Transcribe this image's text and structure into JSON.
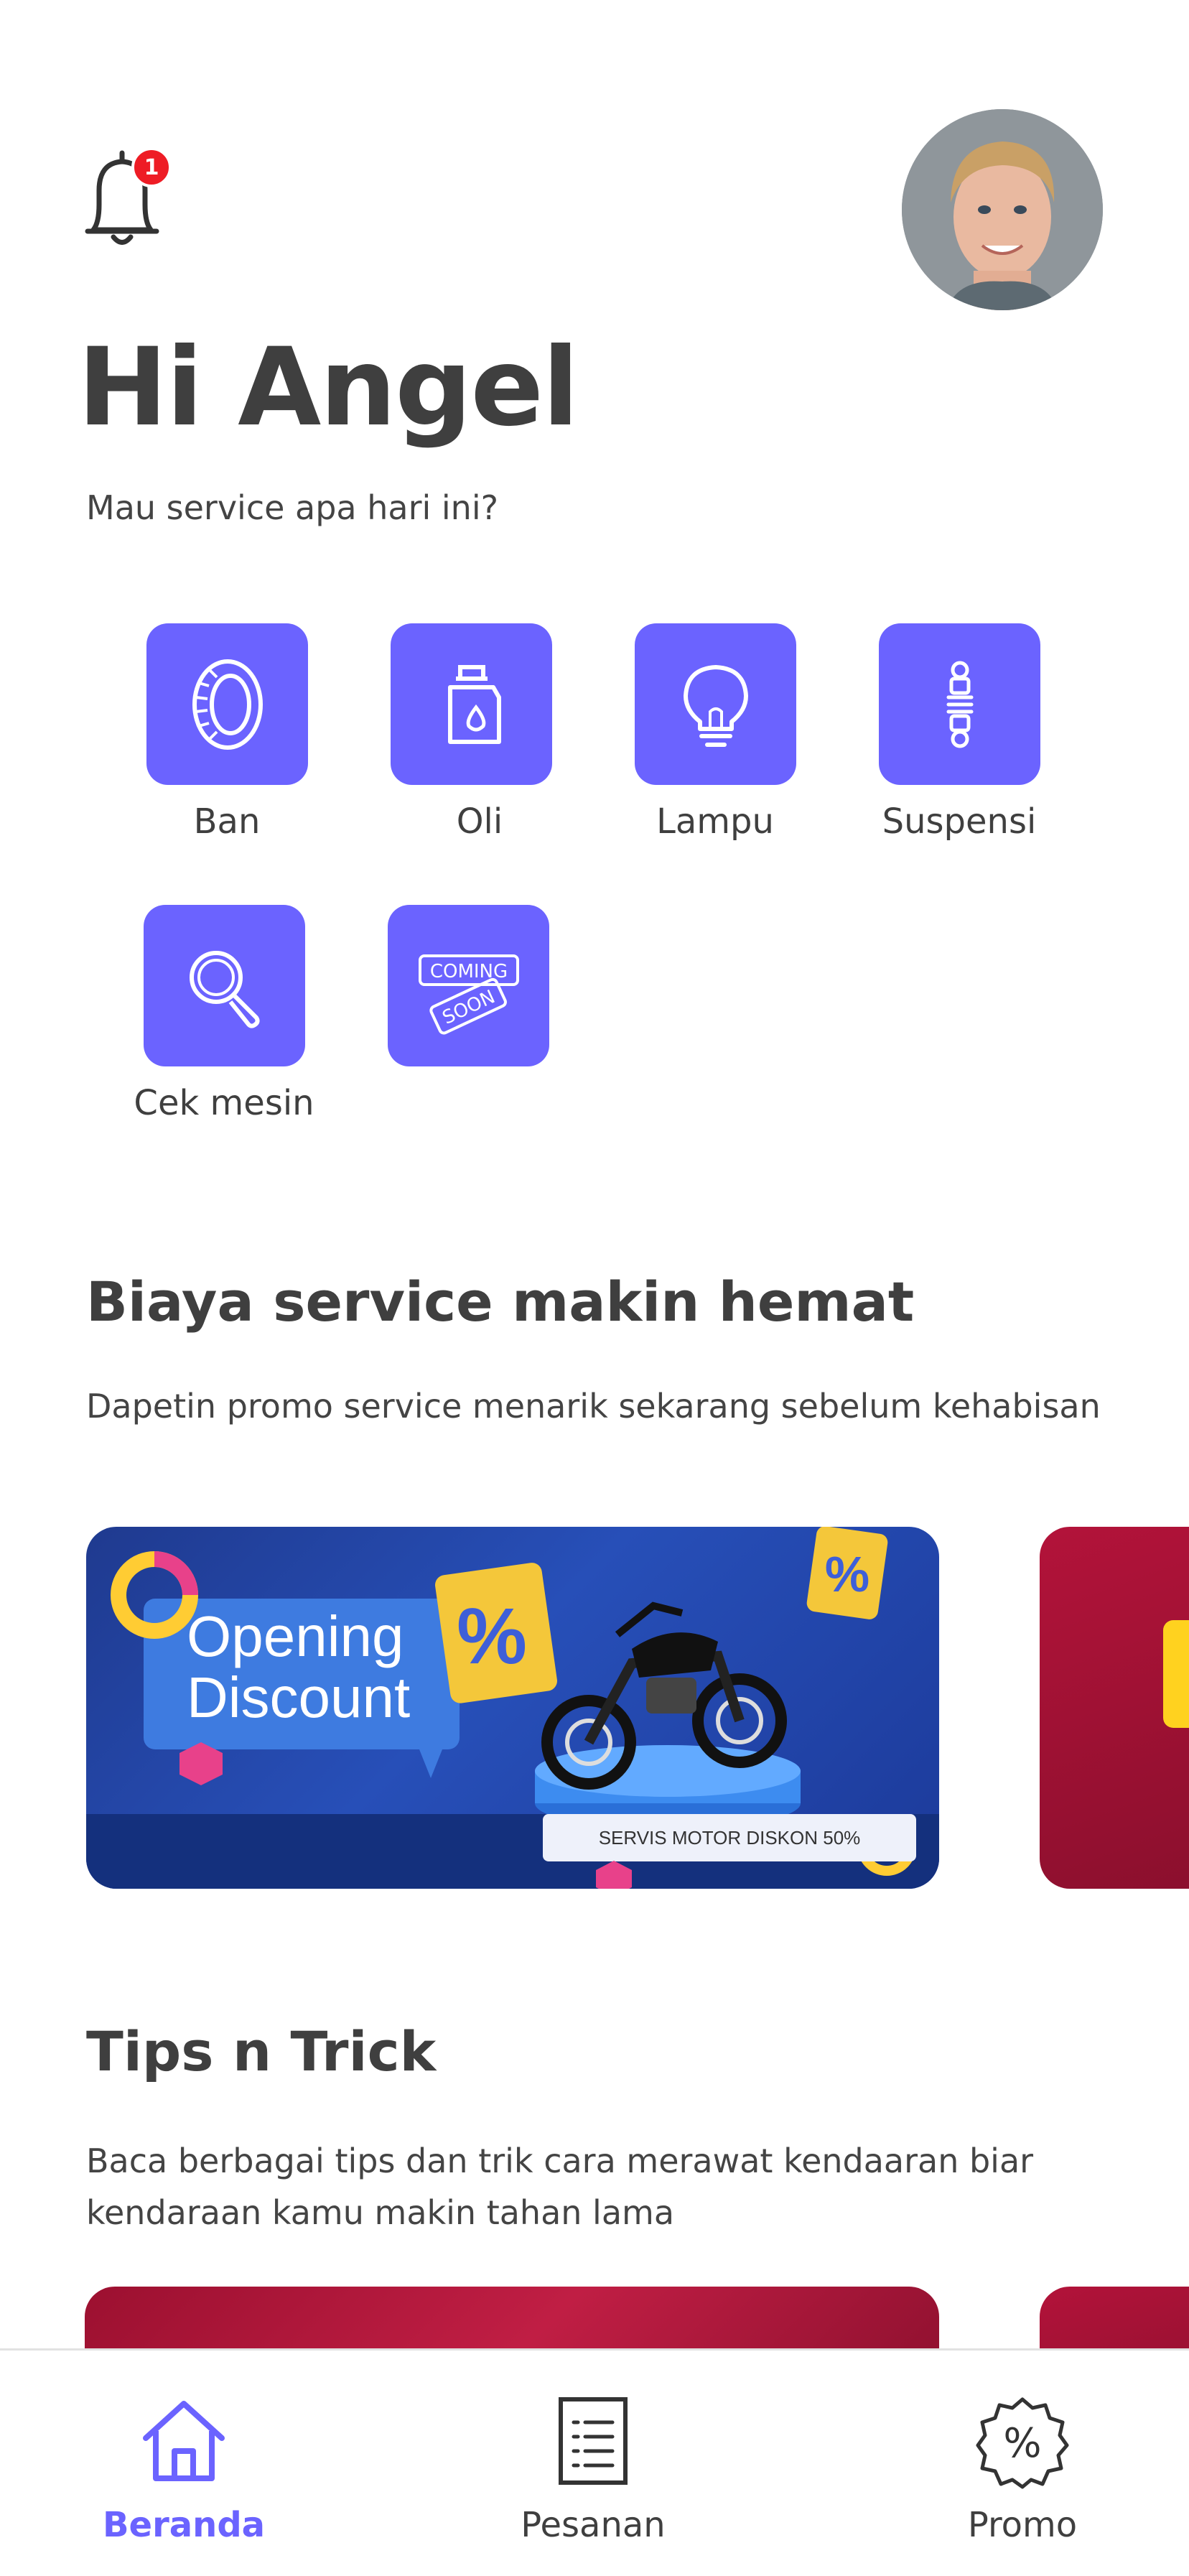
{
  "header": {
    "notification_count": "1",
    "greeting": "Hi Angel",
    "subtitle": "Mau service apa hari ini?"
  },
  "services": [
    {
      "label": "Ban",
      "icon": "tire-icon"
    },
    {
      "label": "Oli",
      "icon": "oil-bottle-icon"
    },
    {
      "label": "Lampu",
      "icon": "light-bulb-icon"
    },
    {
      "label": "Suspensi",
      "icon": "suspension-icon"
    },
    {
      "label": "Cek mesin",
      "icon": "magnifier-icon"
    },
    {
      "label": "",
      "icon": "coming-soon-icon"
    }
  ],
  "coming_soon": {
    "line1": "COMING",
    "line2": "SOON"
  },
  "promo_section": {
    "title": "Biaya service makin hemat",
    "description": "Dapetin promo service menarik sekarang sebelum kehabisan",
    "banner": {
      "headline_1": "Opening",
      "headline_2": "Discount",
      "caption": "SERVIS MOTOR DISKON 50%"
    }
  },
  "tips_section": {
    "title": "Tips n Trick",
    "description": "Baca berbagai tips dan trik cara merawat kendaaran biar kendaraan kamu makin tahan lama"
  },
  "bottom_nav": [
    {
      "label": "Beranda",
      "icon": "home-icon",
      "active": true
    },
    {
      "label": "Pesanan",
      "icon": "document-list-icon",
      "active": false
    },
    {
      "label": "Promo",
      "icon": "discount-badge-icon",
      "active": false
    }
  ],
  "colors": {
    "accent": "#6b63ff",
    "text": "#3f3f3f",
    "badge": "#ee1c25"
  }
}
